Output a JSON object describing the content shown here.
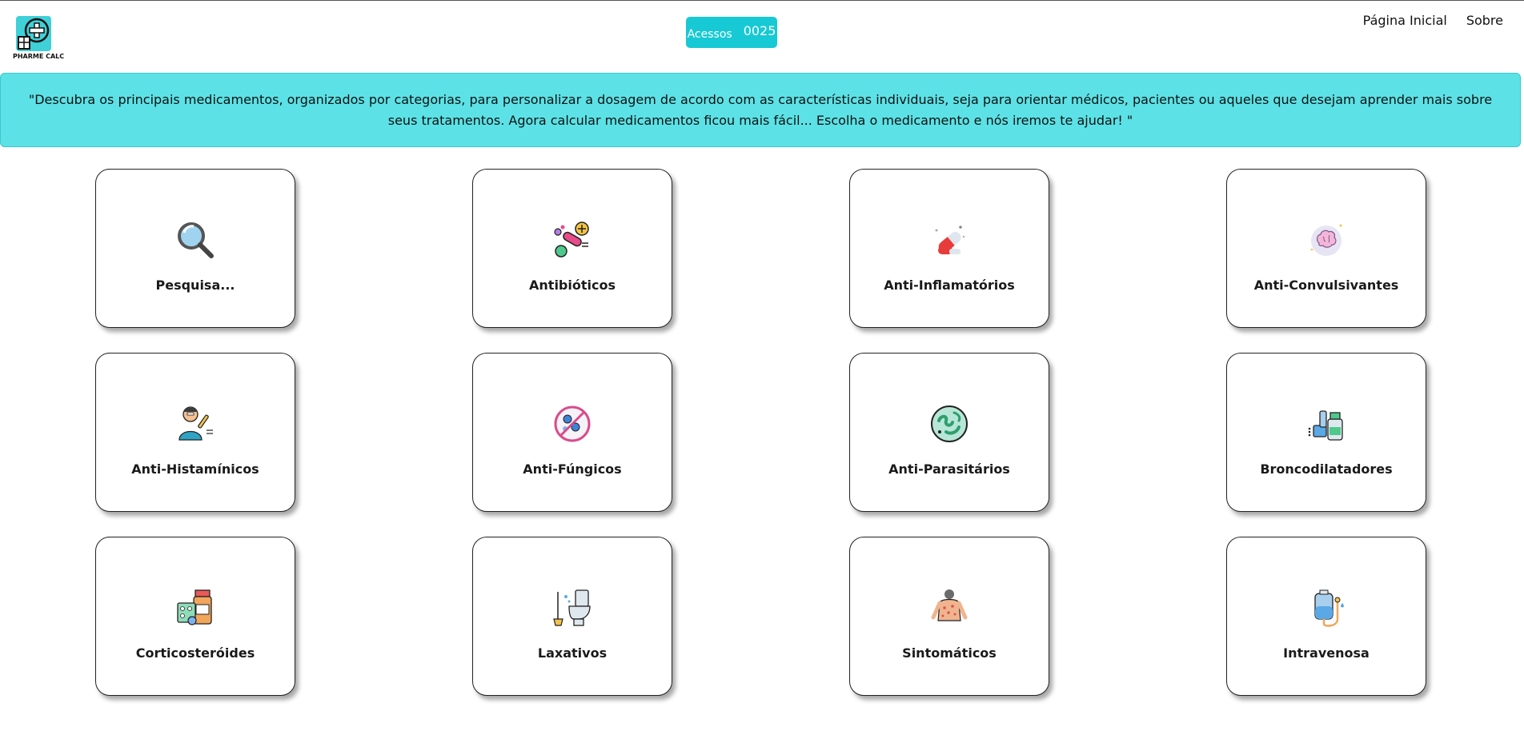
{
  "header": {
    "logo_text": "PHARME CALC",
    "acessos_label": "Acessos",
    "acessos_count": "0025",
    "nav": [
      "Página Inicial",
      "Sobre"
    ]
  },
  "banner": {
    "text": "\"Descubra os principais medicamentos, organizados por categorias, para personalizar a dosagem de acordo com as características individuais, seja para orientar médicos, pacientes ou aqueles que desejam aprender mais sobre seus tratamentos. Agora calcular medicamentos ficou mais fácil... Escolha o medicamento e nós iremos te ajudar! \""
  },
  "categories": [
    {
      "label": "Pesquisa...",
      "icon": "magnifier-icon"
    },
    {
      "label": "Antibióticos",
      "icon": "pills-icon"
    },
    {
      "label": "Anti-Inflamatórios",
      "icon": "capsule-icon"
    },
    {
      "label": "Anti-Convulsivantes",
      "icon": "brain-icon"
    },
    {
      "label": "Anti-Histamínicos",
      "icon": "allergy-person-icon"
    },
    {
      "label": "Anti-Fúngicos",
      "icon": "fungus-icon"
    },
    {
      "label": "Anti-Parasitários",
      "icon": "parasite-icon"
    },
    {
      "label": "Broncodilatadores",
      "icon": "inhaler-icon"
    },
    {
      "label": "Corticosteróides",
      "icon": "medicine-bottle-icon"
    },
    {
      "label": "Laxativos",
      "icon": "toilet-icon"
    },
    {
      "label": "Sintomáticos",
      "icon": "body-symptoms-icon"
    },
    {
      "label": "Intravenosa",
      "icon": "iv-bag-icon"
    }
  ],
  "colors": {
    "accent": "#17c9d4",
    "banner": "#5ce2e6"
  }
}
